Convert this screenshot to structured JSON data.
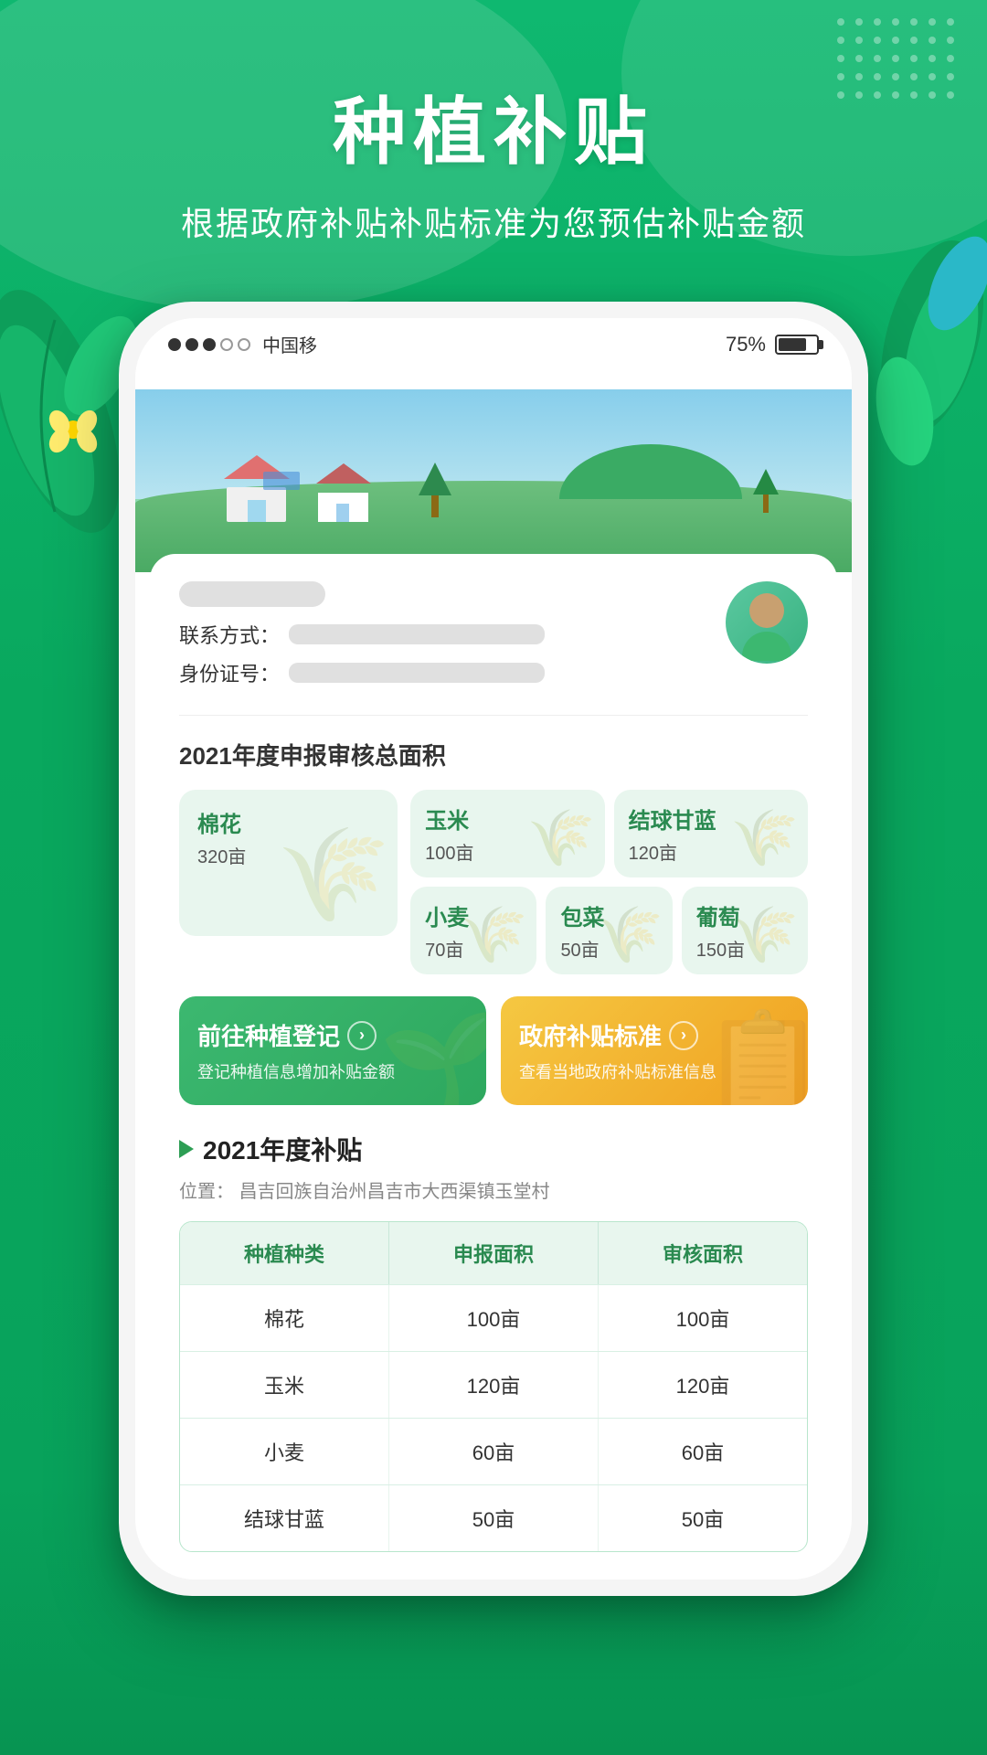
{
  "page": {
    "title_main": "种植补贴",
    "title_sub": "根据政府补贴补贴标准为您预估补贴金额"
  },
  "status_bar": {
    "carrier": "中国移",
    "battery_percent": "75%",
    "signal_dots": 3
  },
  "nav": {
    "back_icon": "‹",
    "title": "种植补贴"
  },
  "user": {
    "contact_label": "联系方式：",
    "id_label": "身份证号："
  },
  "year_section": {
    "title": "2021年度申报审核总面积"
  },
  "crops": [
    {
      "name": "棉花",
      "area": "320亩",
      "size": "large"
    },
    {
      "name": "玉米",
      "area": "100亩",
      "size": "small"
    },
    {
      "name": "结球甘蓝",
      "area": "120亩",
      "size": "small"
    },
    {
      "name": "小麦",
      "area": "70亩",
      "size": "small"
    },
    {
      "name": "包菜",
      "area": "50亩",
      "size": "small"
    },
    {
      "name": "葡萄",
      "area": "150亩",
      "size": "small"
    }
  ],
  "buttons": {
    "register": {
      "main": "前往种植登记",
      "sub": "登记种植信息增加补贴金额",
      "arrow": "›"
    },
    "standard": {
      "main": "政府补贴标准",
      "sub": "查看当地政府补贴标准信息",
      "arrow": "›"
    }
  },
  "subsidy_section": {
    "title": "2021年度补贴",
    "location_label": "位置：",
    "location": "昌吉回族自治州昌吉市大西渠镇玉堂村",
    "table": {
      "headers": [
        "种植种类",
        "申报面积",
        "审核面积"
      ],
      "rows": [
        {
          "crop": "棉花",
          "declared": "100亩",
          "reviewed": "100亩"
        },
        {
          "crop": "玉米",
          "declared": "120亩",
          "reviewed": "120亩"
        },
        {
          "crop": "小麦",
          "declared": "60亩",
          "reviewed": "60亩"
        },
        {
          "crop": "结球甘蓝",
          "declared": "50亩",
          "reviewed": "50亩"
        }
      ]
    }
  },
  "colors": {
    "primary_green": "#2da85e",
    "light_green_bg": "#e8f6ee",
    "orange": "#f0a020",
    "text_dark": "#222",
    "text_mid": "#555",
    "text_light": "#888"
  }
}
